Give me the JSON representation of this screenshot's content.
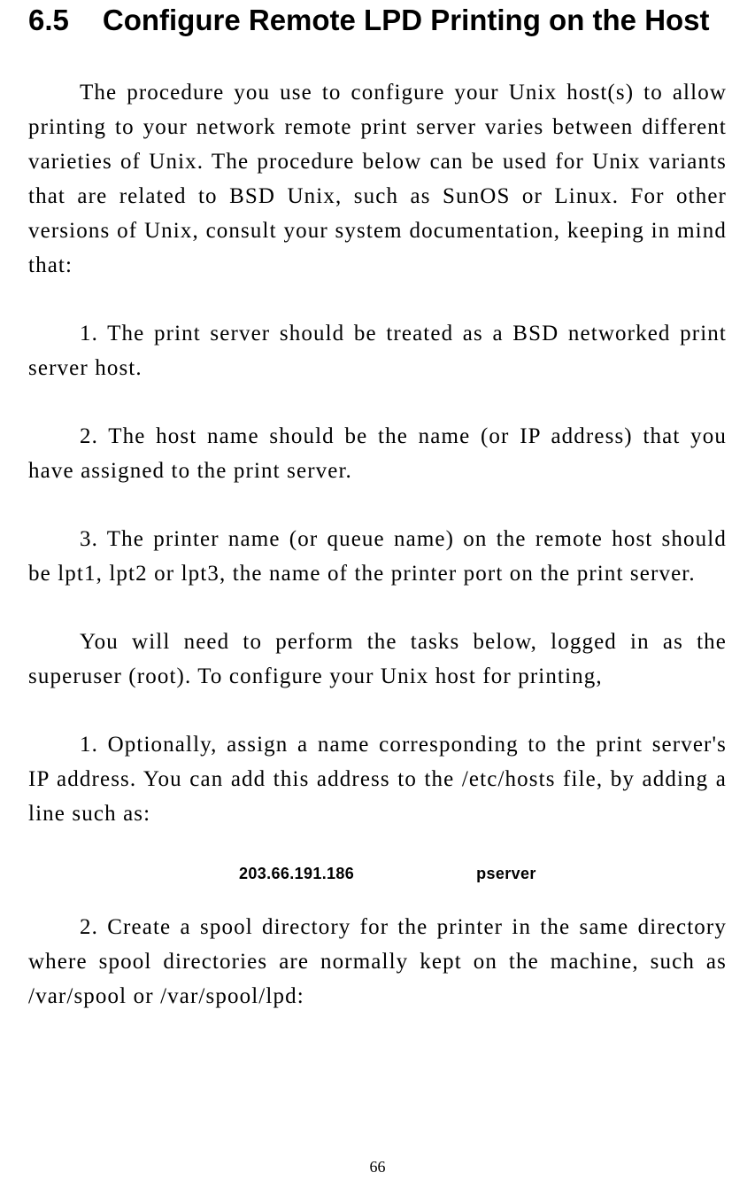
{
  "heading": {
    "number": "6.5",
    "title": "Configure Remote LPD Printing on the Host"
  },
  "paragraphs": {
    "p1": "The procedure you use to configure your Unix host(s) to allow printing to your network remote print server varies between different varieties of Unix.  The procedure below can be used for Unix variants that are related to BSD Unix, such as SunOS or Linux.  For other versions of Unix, consult your system documentation, keeping in mind that:",
    "p2": "1.  The print server should be treated as a BSD networked print server host.",
    "p3": "2.  The host name should be the name (or IP address) that you have assigned to the print server.",
    "p4": "3.  The printer name (or queue name) on the remote host should be lpt1, lpt2 or lpt3, the name of the printer port on the print server.",
    "p5": "You will need to perform the tasks below, logged in as the superuser (root).  To configure your Unix host for printing,",
    "p6": "1.  Optionally, assign a name corresponding to the print server's IP address.  You can add this address to the /etc/hosts file, by adding a line such as:",
    "p7": "2.  Create a spool directory for the printer in the same directory where spool directories are normally kept on the machine, such as /var/spool or /var/spool/lpd:"
  },
  "code": {
    "ip": "203.66.191.186",
    "host": "pserver"
  },
  "page_number": "66"
}
